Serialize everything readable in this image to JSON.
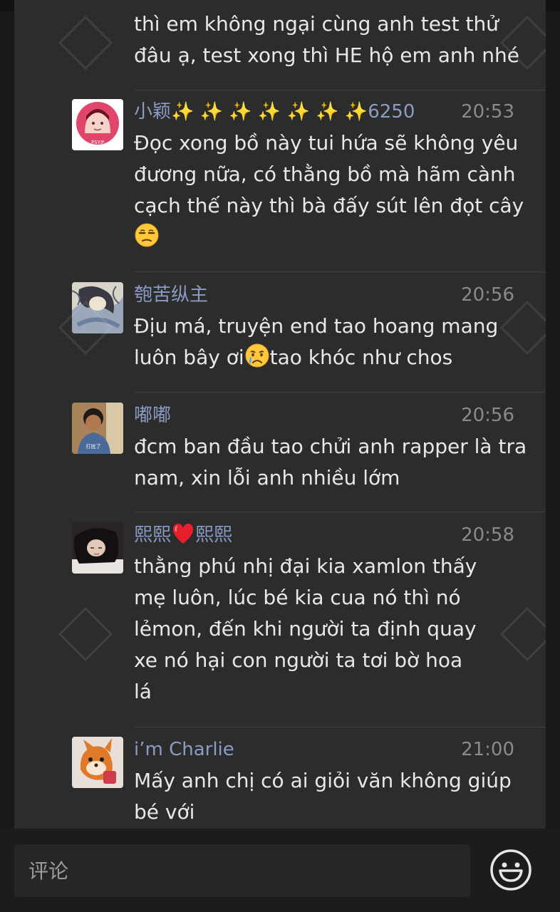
{
  "first_comment_tail": "thì em không ngại cùng anh test thử\nđâu ạ, test xong thì HE hộ em anh nhé",
  "comments": [
    {
      "name": "小颖✨ ✨ ✨ ✨ ✨ ✨ ✨6250",
      "time": "20:53",
      "text": "Đọc xong bồ này tui hứa sẽ không yêu đương nữa, có thằng bồ mà hãm cành cạch thế này thì bà đấy sút lên đọt cây",
      "emoji": "unamused-face-emoji"
    },
    {
      "name": "匏苦纵主",
      "time": "20:56",
      "text_before": "Địu má, truyện end tao hoang mang luôn bây ơi",
      "text_after": "tao khóc như chos",
      "emoji": "crying-face-emoji"
    },
    {
      "name": "嘟嘟",
      "time": "20:56",
      "text": "đcm ban đầu tao chửi anh rapper là tra nam, xin lỗi anh nhiều lớm"
    },
    {
      "name_part1": "熙熙",
      "name_part2": "熙熙",
      "time": "20:58",
      "text": "thằng phú nhị đại kia xamlon thấy mẹ luôn, lúc bé kia cua nó thì nó lẻmon, đến khi người ta định quay xe nó hại con người ta tơi bờ hoa lá",
      "name_emoji": "red-heart-emoji"
    },
    {
      "name": "i’m Charlie",
      "time": "21:00",
      "text": "Mấy anh chị có ai giỏi văn không giúp bé với"
    }
  ],
  "avatar1_label": "PSY.P",
  "avatar3_label": "打扰了",
  "input": {
    "placeholder": "评论"
  },
  "colors": {
    "panel_bg": "#2c2c2c",
    "page_bg": "#191919",
    "name": "#8a9bc4",
    "time": "#8a8a8a",
    "text": "#e8e8e8"
  },
  "icons": {
    "emoji_button": "smiley-face-icon"
  }
}
